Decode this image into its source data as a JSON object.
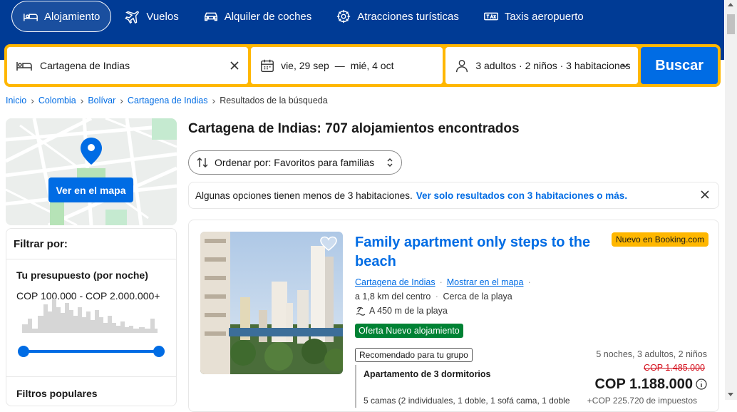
{
  "nav": {
    "tabs": [
      {
        "label": "Alojamiento",
        "icon": "bed-icon",
        "active": true
      },
      {
        "label": "Vuelos",
        "icon": "plane-icon",
        "active": false
      },
      {
        "label": "Alquiler de coches",
        "icon": "car-icon",
        "active": false
      },
      {
        "label": "Atracciones turísticas",
        "icon": "attractions-icon",
        "active": false
      },
      {
        "label": "Taxis aeropuerto",
        "icon": "taxi-icon",
        "active": false
      }
    ]
  },
  "search": {
    "destination": "Cartagena de Indias",
    "checkin": "vie, 29 sep",
    "dash": "—",
    "checkout": "mié, 4 oct",
    "occupancy": "3 adultos · 2 niños · 3 habitaciones",
    "button": "Buscar"
  },
  "breadcrumb": [
    "Inicio",
    "Colombia",
    "Bolívar",
    "Cartagena de Indias",
    "Resultados de la búsqueda"
  ],
  "map": {
    "button": "Ver en el mapa"
  },
  "filters": {
    "title": "Filtrar por:",
    "budget_title": "Tu presupuesto (por noche)",
    "budget_range": "COP 100.000 - COP 2.000.000+",
    "popular_title": "Filtros populares"
  },
  "results": {
    "title": "Cartagena de Indias: 707 alojamientos encontrados",
    "sort_label": "Ordenar por: Favoritos para familias",
    "notice_text": "Algunas opciones tienen menos de 3 habitaciones.",
    "notice_link": "Ver solo resultados con 3 habitaciones o más."
  },
  "property": {
    "name": "Family apartment only steps to the beach",
    "badge": "Nuevo en Booking.com",
    "location": "Cartagena de Indias",
    "map_link": "Mostrar en el mapa",
    "distance": "a 1,8 km del centro",
    "near_beach": "Cerca de la playa",
    "beach_distance": "A 450 m de la playa",
    "offer": "Oferta Nuevo alojamiento",
    "recommended": "Recomendado para tu grupo",
    "room": "Apartamento de 3 dormitorios",
    "room_desc": "5 camas (2 individuales, 1 doble, 1 sofá cama, 1 doble",
    "stay": "5 noches, 3 adultos, 2 niños",
    "old_price": "COP 1.485.000",
    "price": "COP 1.188.000",
    "taxes": "+COP 225.720 de impuestos"
  }
}
